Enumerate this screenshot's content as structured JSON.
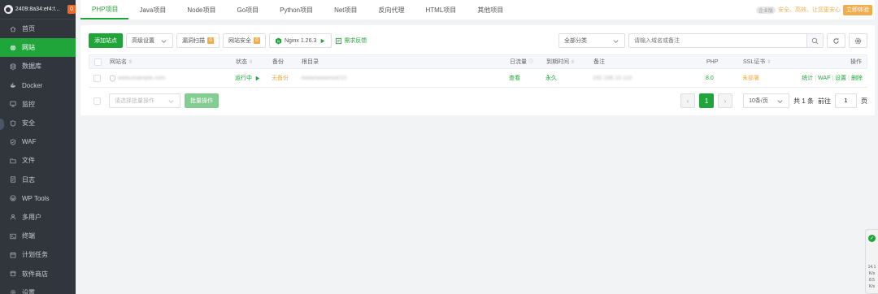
{
  "sidebar": {
    "host": "2409:8a34:ef4:f...",
    "badge": "0",
    "items": [
      {
        "label": "首页",
        "icon": "home-icon"
      },
      {
        "label": "网站",
        "icon": "globe-icon",
        "active": true
      },
      {
        "label": "数据库",
        "icon": "database-icon"
      },
      {
        "label": "Docker",
        "icon": "docker-icon"
      },
      {
        "label": "监控",
        "icon": "monitor-icon"
      },
      {
        "label": "安全",
        "icon": "shield-icon"
      },
      {
        "label": "WAF",
        "icon": "waf-shield-icon"
      },
      {
        "label": "文件",
        "icon": "folder-icon"
      },
      {
        "label": "日志",
        "icon": "log-icon"
      },
      {
        "label": "WP Tools",
        "icon": "wordpress-icon"
      },
      {
        "label": "多用户",
        "icon": "users-icon"
      },
      {
        "label": "终端",
        "icon": "terminal-icon"
      },
      {
        "label": "计划任务",
        "icon": "calendar-icon"
      },
      {
        "label": "软件商店",
        "icon": "store-icon"
      },
      {
        "label": "设置",
        "icon": "gear-icon"
      }
    ]
  },
  "tabs": [
    "PHP项目",
    "Java项目",
    "Node项目",
    "Go项目",
    "Python项目",
    "Net项目",
    "反向代理",
    "HTML项目",
    "其他项目"
  ],
  "topbar": {
    "ent_tag": "企业版",
    "slogan": "安全、高效、让您更安心",
    "cta": "立即体验"
  },
  "toolbar": {
    "add_site": "添加站点",
    "advanced": "高级设置",
    "vuln_scan": "漏洞扫描",
    "vuln_count": "0",
    "site_security": "网站安全",
    "security_count": "0",
    "nginx": "Nginx 1.26.3",
    "feedback": "需求反馈",
    "category": "全部分类",
    "search_placeholder": "请输入域名或备注"
  },
  "table": {
    "headers": {
      "name": "网站名",
      "status": "状态",
      "backup": "备份",
      "root": "根目录",
      "traffic": "日流量",
      "expire": "到期时间",
      "remark": "备注",
      "php": "PHP",
      "ssl": "SSL证书",
      "ops": "操作"
    },
    "rows": [
      {
        "name": "www.example.com",
        "status": "运行中",
        "backup": "无备份",
        "root": "/www/wwwroot/10.",
        "traffic": "查看",
        "expire": "永久",
        "remark": "192.168.10.110",
        "php": "8.0",
        "ssl": "未部署",
        "actions": [
          "统计",
          "WAF",
          "设置",
          "删除"
        ]
      }
    ]
  },
  "footer": {
    "batch_placeholder": "请选择批量操作",
    "batch_btn": "批量操作",
    "page": "1",
    "page_size": "10条/页",
    "total": "共 1 条",
    "goto": "前往",
    "goto_value": "1",
    "page_unit": "页"
  },
  "float_widget": {
    "check": "✓",
    "stats": [
      "14.1",
      "K/s",
      "8.5",
      "K/s"
    ]
  },
  "colors": {
    "accent": "#20a53a",
    "sidebar_bg": "#31363d",
    "warning": "#f0ad4e",
    "danger": "#ef0808"
  }
}
